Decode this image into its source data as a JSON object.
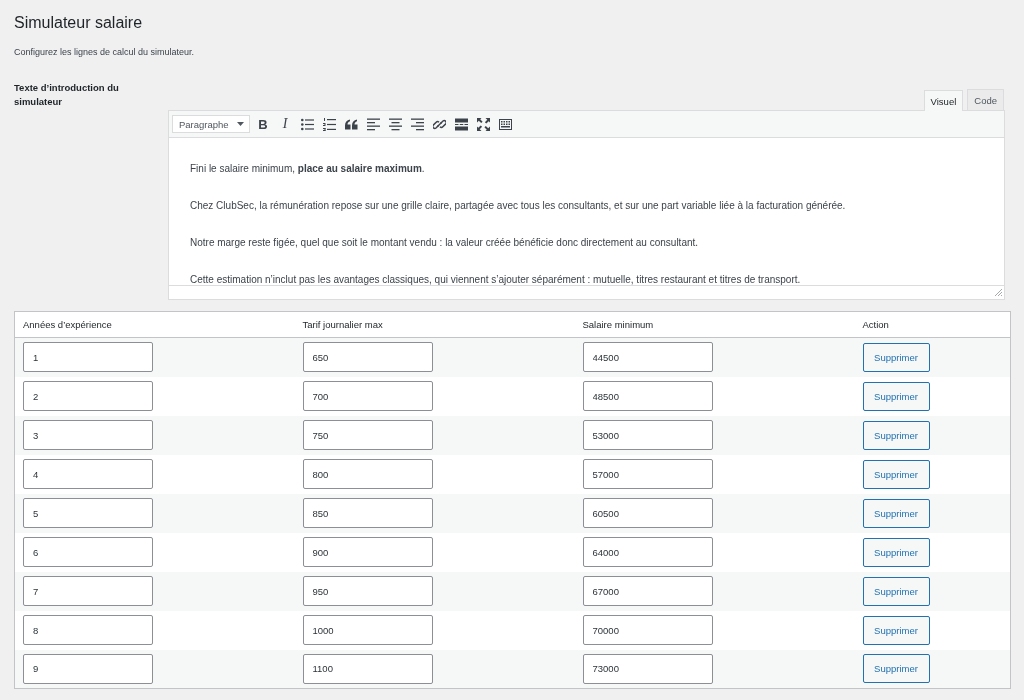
{
  "page": {
    "title": "Simulateur salaire",
    "description": "Configurez les lignes de calcul du simulateur."
  },
  "intro_field": {
    "label": "Texte d’introduction du simulateur",
    "editor": {
      "tabs": [
        {
          "label": "Visuel",
          "selected": true
        },
        {
          "label": "Code",
          "selected": false
        }
      ],
      "format": "Paragraphe",
      "toolbar": [
        {
          "kind": "bold",
          "label": "B"
        },
        {
          "kind": "italic",
          "label": "I"
        },
        {
          "kind": "bullets"
        },
        {
          "kind": "numbers"
        },
        {
          "kind": "quote"
        },
        {
          "kind": "align-left"
        },
        {
          "kind": "align-center"
        },
        {
          "kind": "align-right"
        },
        {
          "kind": "link"
        },
        {
          "kind": "more"
        },
        {
          "kind": "fullscreen"
        },
        {
          "kind": "kitchen-sink"
        }
      ],
      "paragraphs": [
        "Fini le salaire minimum, **place au salaire maximum**.",
        "Chez ClubSec, la rémunération repose sur une grille claire, partagée avec tous les consultants, et sur une part variable liée à la facturation générée.",
        "Notre marge reste figée, quel que soit le montant vendu : la valeur créée bénéficie donc directement au consultant.",
        "Cette estimation n’inclut pas les avantages classiques, qui viennent s’ajouter séparément : mutuelle, titres restaurant et titres de transport."
      ]
    }
  },
  "table": {
    "columns": [
      "Années d’expérience",
      "Tarif journalier max",
      "Salaire minimum",
      "Action"
    ],
    "rows": [
      {
        "values": [
          "1",
          "650",
          "44500"
        ],
        "action": "Supprimer"
      },
      {
        "values": [
          "2",
          "700",
          "48500"
        ],
        "action": "Supprimer"
      },
      {
        "values": [
          "3",
          "750",
          "53000"
        ],
        "action": "Supprimer"
      },
      {
        "values": [
          "4",
          "800",
          "57000"
        ],
        "action": "Supprimer"
      },
      {
        "values": [
          "5",
          "850",
          "60500"
        ],
        "action": "Supprimer"
      },
      {
        "values": [
          "6",
          "900",
          "64000"
        ],
        "action": "Supprimer"
      },
      {
        "values": [
          "7",
          "950",
          "67000"
        ],
        "action": "Supprimer"
      },
      {
        "values": [
          "8",
          "1000",
          "70000"
        ],
        "action": "Supprimer"
      },
      {
        "values": [
          "9",
          "1100",
          "73000"
        ],
        "action": "Supprimer"
      }
    ]
  }
}
